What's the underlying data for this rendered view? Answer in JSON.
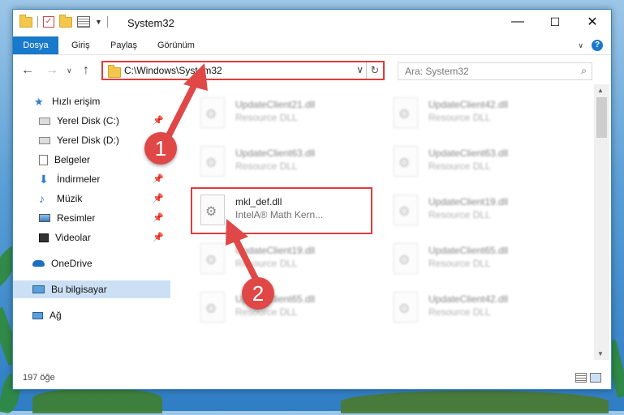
{
  "window": {
    "title": "System32",
    "controls": [
      "—",
      "☐",
      "✕"
    ]
  },
  "ribbon": {
    "tabs": [
      "Dosya",
      "Giriş",
      "Paylaş",
      "Görünüm"
    ],
    "help": "?"
  },
  "address": {
    "path": "C:\\Windows\\System32"
  },
  "search": {
    "placeholder": "Ara: System32"
  },
  "sidebar": {
    "items": [
      {
        "label": "Hızlı erişim",
        "icon": "star-icon",
        "pinned": false
      },
      {
        "label": "Yerel Disk (C:)",
        "icon": "drive-icon",
        "pinned": true
      },
      {
        "label": "Yerel Disk (D:)",
        "icon": "drive-icon",
        "pinned": false
      },
      {
        "label": "Belgeler",
        "icon": "documents-icon",
        "pinned": true
      },
      {
        "label": "İndirmeler",
        "icon": "download-icon",
        "pinned": true
      },
      {
        "label": "Müzik",
        "icon": "music-icon",
        "pinned": true
      },
      {
        "label": "Resimler",
        "icon": "pictures-icon",
        "pinned": true
      },
      {
        "label": "Videolar",
        "icon": "videos-icon",
        "pinned": true
      },
      {
        "label": "OneDrive",
        "icon": "cloud-icon",
        "pinned": false
      },
      {
        "label": "Bu bilgisayar",
        "icon": "computer-icon",
        "pinned": false
      },
      {
        "label": "Ağ",
        "icon": "network-icon",
        "pinned": false
      }
    ]
  },
  "files": [
    {
      "name": "UpdateClient21.dll",
      "desc": "Resource DLL"
    },
    {
      "name": "UpdateClient42.dll",
      "desc": "Resource DLL"
    },
    {
      "name": "UpdateClient63.dll",
      "desc": "Resource DLL"
    },
    {
      "name": "UpdateClient63.dll",
      "desc": "Resource DLL"
    },
    {
      "name": "mkl_def.dll",
      "desc": "IntelA® Math Kern..."
    },
    {
      "name": "UpdateClient19.dll",
      "desc": "Resource DLL"
    },
    {
      "name": "UpdateClient19.dll",
      "desc": "Resource DLL"
    },
    {
      "name": "UpdateClient65.dll",
      "desc": "Resource DLL"
    },
    {
      "name": "UpdateClient65.dll",
      "desc": "Resource DLL"
    },
    {
      "name": "UpdateClient42.dll",
      "desc": "Resource DLL"
    }
  ],
  "status": {
    "count": "197 öğe"
  },
  "annotations": {
    "step1": "1",
    "step2": "2",
    "color": "#e03c3c"
  }
}
